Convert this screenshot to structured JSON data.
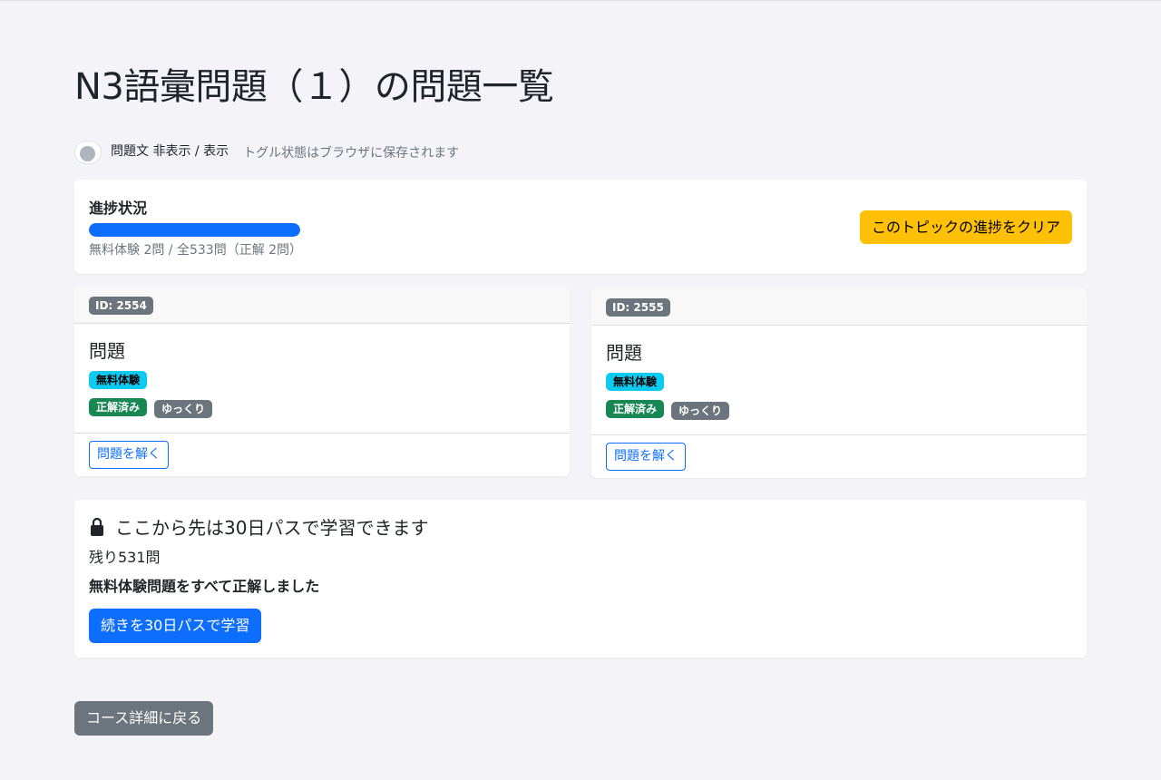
{
  "page": {
    "title": "N3語彙問題（１）の問題一覧"
  },
  "toggle": {
    "label": "問題文 非表示 / 表示",
    "note": "トグル状態はブラウザに保存されます",
    "state": "off"
  },
  "progress": {
    "title": "進捗状況",
    "fraction": 1.0,
    "text": "無料体験 2問 / 全533問（正解 2問）",
    "clear_label": "このトピックの進捗をクリア"
  },
  "questions": [
    {
      "id_label": "ID: 2554",
      "title": "問題",
      "free_badge": "無料体験",
      "correct_badge": "正解済み",
      "speed_badge": "ゆっくり",
      "solve_label": "問題を解く"
    },
    {
      "id_label": "ID: 2555",
      "title": "問題",
      "free_badge": "無料体験",
      "correct_badge": "正解済み",
      "speed_badge": "ゆっくり",
      "solve_label": "問題を解く"
    }
  ],
  "locked": {
    "heading": "ここから先は30日パスで学習できます",
    "remaining": "残り531問",
    "all_correct": "無料体験問題をすべて正解しました",
    "pass_label": "続きを30日パスで学習"
  },
  "back_label": "コース詳細に戻る",
  "colors": {
    "background": "#f3f3f8",
    "primary": "#0d6efd",
    "warning": "#ffc107",
    "info": "#0dcaf0",
    "success": "#198754",
    "secondary": "#6c757d"
  },
  "icons": {
    "lock": "lock-icon"
  }
}
